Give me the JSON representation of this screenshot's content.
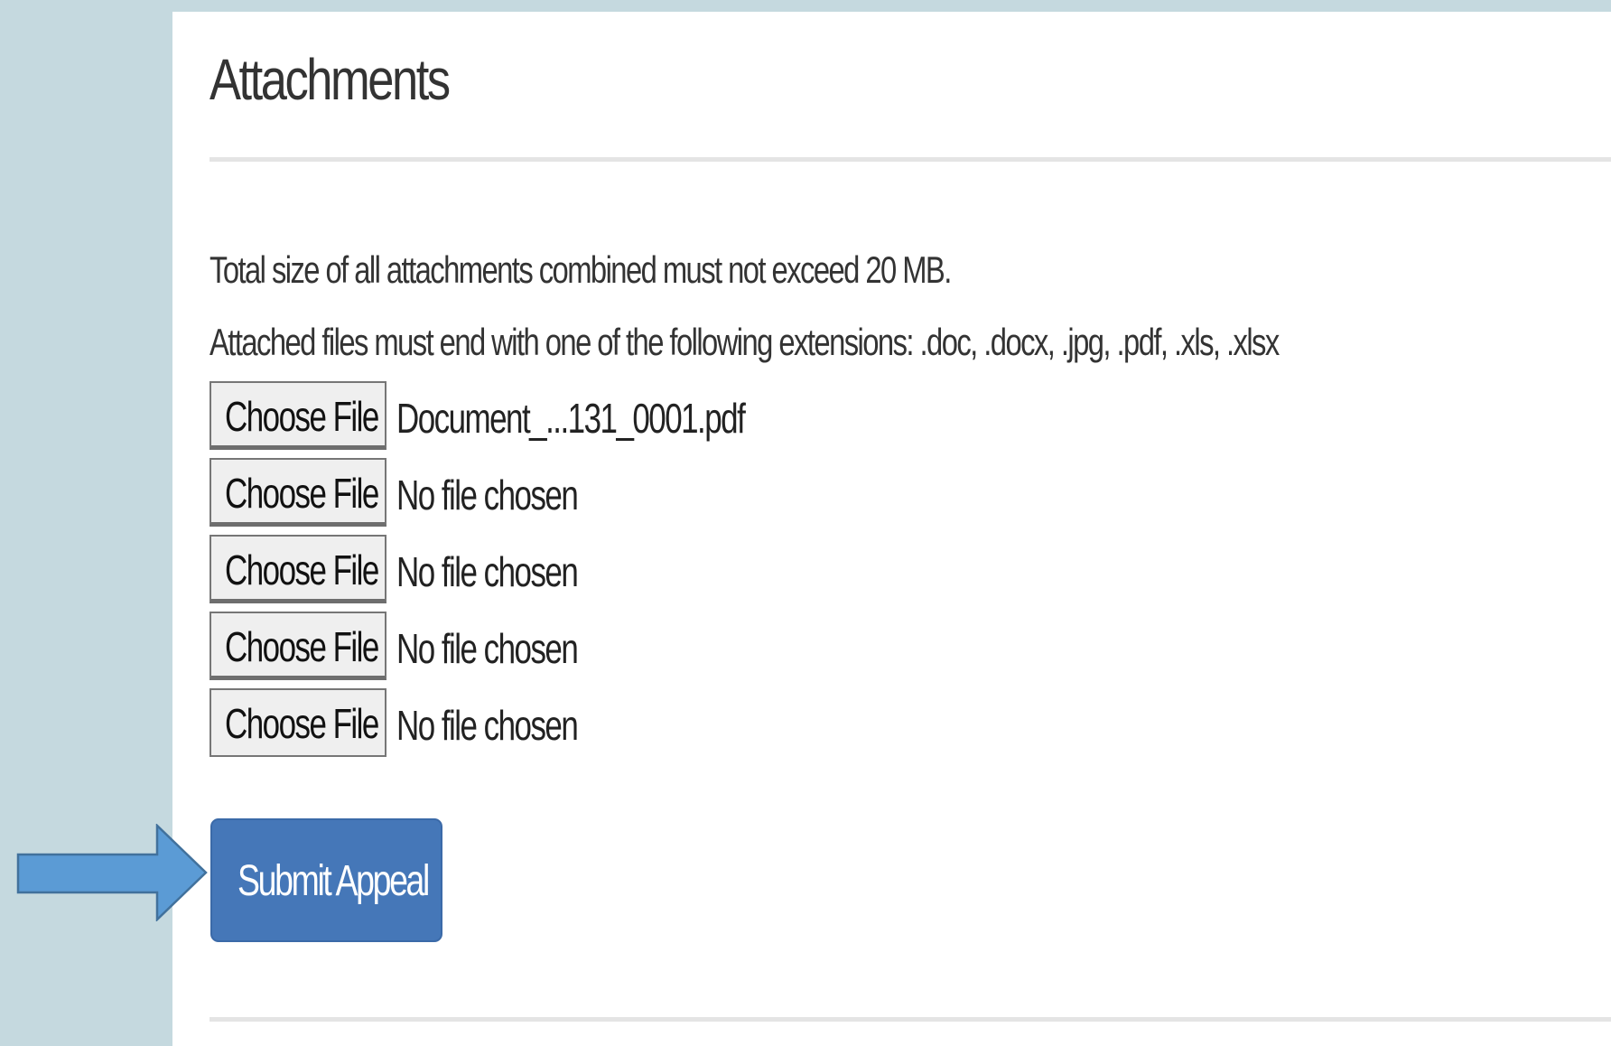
{
  "section": {
    "title": "Attachments"
  },
  "info": {
    "size_limit": "Total size of all attachments combined must not exceed 20 MB.",
    "extensions": "Attached files must end with one of the following extensions: .doc, .docx, .jpg, .pdf, .xls, .xlsx"
  },
  "file_inputs": [
    {
      "button_label": "Choose File",
      "status": "Document_...131_0001.pdf"
    },
    {
      "button_label": "Choose File",
      "status": "No file chosen"
    },
    {
      "button_label": "Choose File",
      "status": "No file chosen"
    },
    {
      "button_label": "Choose File",
      "status": "No file chosen"
    },
    {
      "button_label": "Choose File",
      "status": "No file chosen"
    }
  ],
  "actions": {
    "submit_label": "Submit Appeal"
  },
  "annotation": {
    "icon": "arrow-right-icon",
    "color": "#5b9bd5"
  },
  "colors": {
    "background": "#c5d9df",
    "panel": "#ffffff",
    "primary_button": "#4577b8"
  }
}
